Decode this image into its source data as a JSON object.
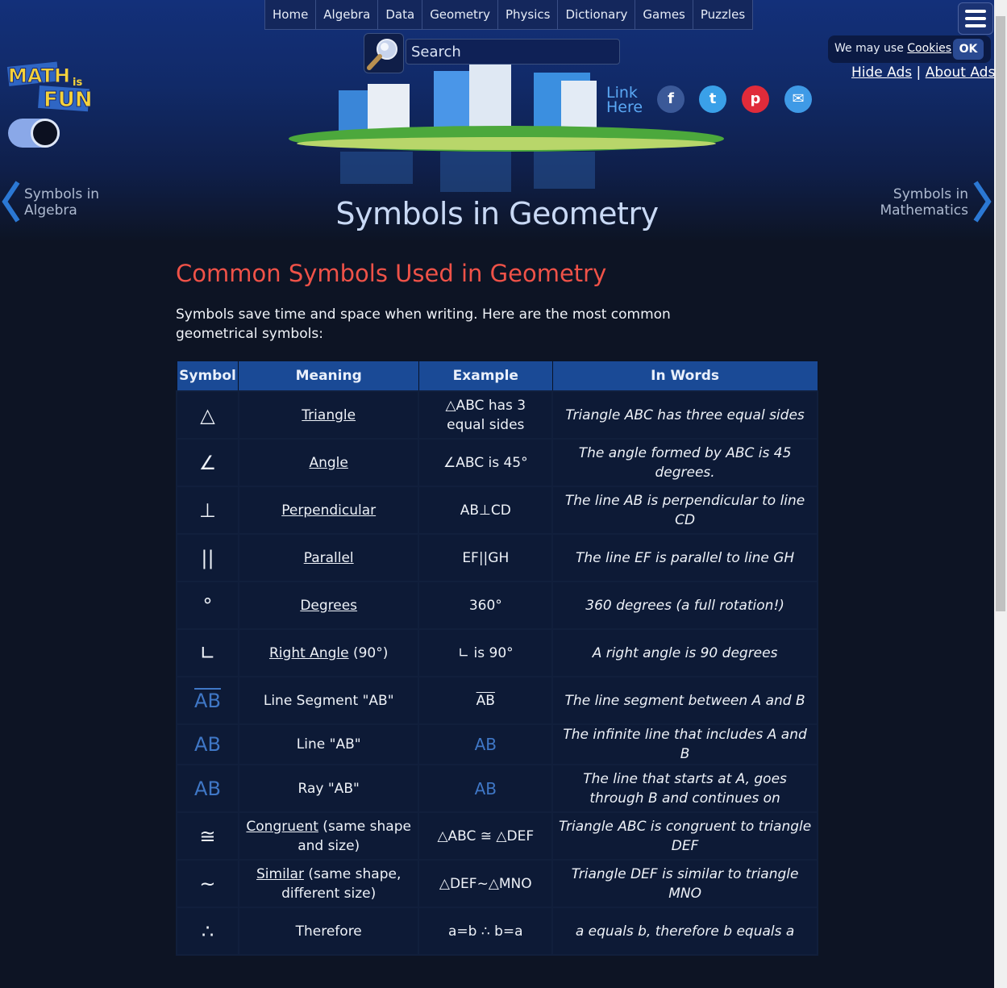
{
  "nav": [
    "Home",
    "Algebra",
    "Data",
    "Geometry",
    "Physics",
    "Dictionary",
    "Games",
    "Puzzles"
  ],
  "search": {
    "placeholder": "Search"
  },
  "cookie": {
    "text": "We may use",
    "link": "Cookies",
    "ok": "OK"
  },
  "ads": {
    "hide": "Hide Ads",
    "sep": "|",
    "about": "About Ads"
  },
  "logo": {
    "line1": "MATH",
    "line2": "is",
    "line3": "FUN"
  },
  "social": {
    "link_here_1": "Link",
    "link_here_2": "Here",
    "facebook": "f",
    "twitter": "t",
    "pinterest": "p",
    "email": "✉"
  },
  "prev": {
    "line1": "Symbols in",
    "line2": "Algebra"
  },
  "next": {
    "line1": "Symbols in",
    "line2": "Mathematics"
  },
  "page_title": "Symbols in Geometry",
  "section_title": "Common Symbols Used in Geometry",
  "intro": "Symbols save time and space when writing. Here are the most common geometrical symbols:",
  "table": {
    "headers": [
      "Symbol",
      "Meaning",
      "Example",
      "In Words"
    ],
    "rows": [
      {
        "symbol": "△",
        "link": "Triangle",
        "rest": "",
        "example": "△ABC has 3 equal sides",
        "words": "Triangle ABC has three equal sides"
      },
      {
        "symbol": "∠",
        "link": "Angle",
        "rest": "",
        "example": "∠ABC is 45°",
        "words": "The angle formed by ABC is 45 degrees."
      },
      {
        "symbol": "⊥",
        "link": "Perpendicular",
        "rest": "",
        "example": "AB⊥CD",
        "words": "The line AB is perpendicular to line CD"
      },
      {
        "symbol": "||",
        "link": "Parallel",
        "rest": "",
        "example": "EF||GH",
        "words": "The line EF is parallel to line GH"
      },
      {
        "symbol": "°",
        "link": "Degrees",
        "rest": "",
        "example": "360°",
        "words": "360 degrees (a full rotation!)"
      },
      {
        "symbol": "∟",
        "link": "Right Angle",
        "rest": " (90°)",
        "example": "∟ is 90°",
        "words": "A right angle is 90 degrees"
      },
      {
        "symbol": "AB",
        "link": "",
        "rest": "Line Segment \"AB\"",
        "example": "AB",
        "words": "The line segment between A and B"
      },
      {
        "symbol": "AB",
        "link": "",
        "rest": "Line \"AB\"",
        "example": "AB",
        "words": "The infinite line that includes A and B"
      },
      {
        "symbol": "AB",
        "link": "",
        "rest": "Ray \"AB\"",
        "example": "AB",
        "words": "The line that starts at A, goes through B and continues on"
      },
      {
        "symbol": "≅",
        "link": "Congruent",
        "rest": " (same shape and size)",
        "example": "△ABC ≅ △DEF",
        "words": "Triangle ABC is congruent to triangle DEF"
      },
      {
        "symbol": "~",
        "link": "Similar",
        "rest": " (same shape, different size)",
        "example": "△DEF~△MNO",
        "words": "Triangle DEF is similar to triangle MNO"
      },
      {
        "symbol": "∴",
        "link": "",
        "rest": "Therefore",
        "example": "a=b ∴ b=a",
        "words": "a equals b, therefore b equals a"
      }
    ]
  }
}
